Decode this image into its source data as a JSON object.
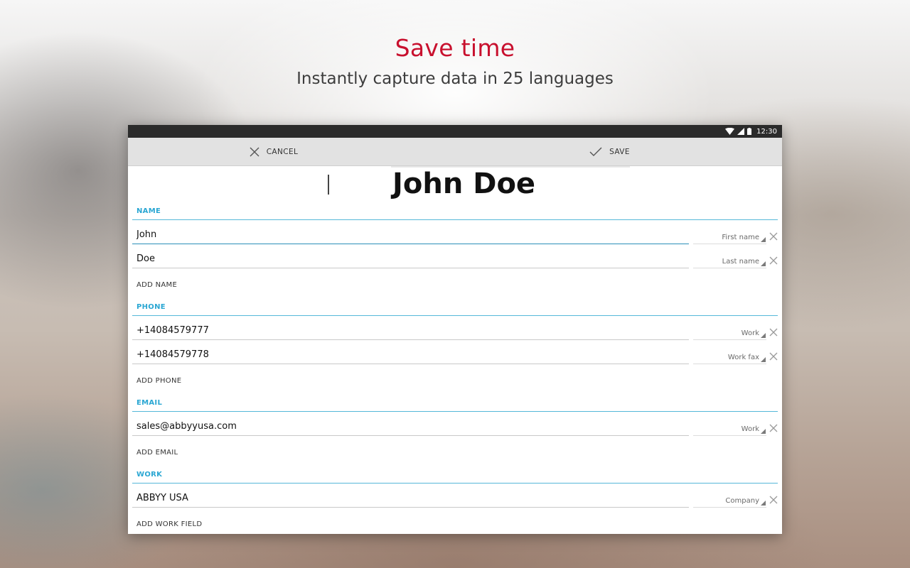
{
  "hero": {
    "title": "Save time",
    "subtitle": "Instantly capture data in 25 languages"
  },
  "statusbar": {
    "time": "12:30"
  },
  "actionbar": {
    "cancel_label": "CANCEL",
    "save_label": "SAVE"
  },
  "scan": {
    "text": "John Doe"
  },
  "sections": {
    "name": {
      "label": "NAME",
      "fields": [
        {
          "value": "John",
          "type": "First name"
        },
        {
          "value": "Doe",
          "type": "Last name"
        }
      ],
      "add_label": "ADD NAME"
    },
    "phone": {
      "label": "PHONE",
      "fields": [
        {
          "value": "+14084579777",
          "type": "Work"
        },
        {
          "value": "+14084579778",
          "type": "Work fax"
        }
      ],
      "add_label": "ADD PHONE"
    },
    "email": {
      "label": "EMAIL",
      "fields": [
        {
          "value": "sales@abbyyusa.com",
          "type": "Work"
        }
      ],
      "add_label": "ADD EMAIL"
    },
    "work": {
      "label": "WORK",
      "fields": [
        {
          "value": "ABBYY USA",
          "type": "Company"
        }
      ],
      "add_label": "ADD WORK FIELD"
    }
  },
  "colors": {
    "accent_red": "#c8102e",
    "section_blue": "#2ba7d3"
  }
}
